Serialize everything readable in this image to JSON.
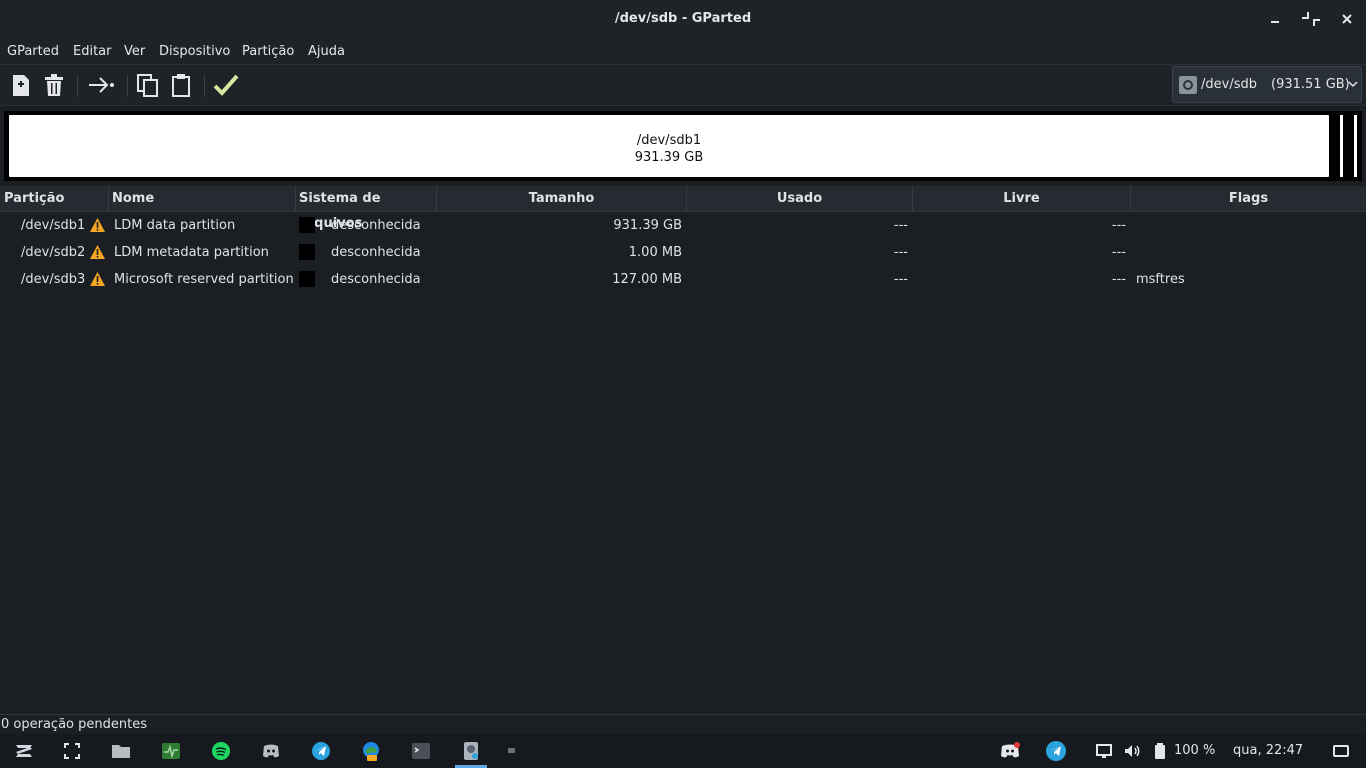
{
  "window": {
    "title": "/dev/sdb - GParted"
  },
  "menu": [
    "GParted",
    "Editar",
    "Ver",
    "Dispositivo",
    "Partição",
    "Ajuda"
  ],
  "toolbar": {
    "icons": [
      "new-partition-icon",
      "delete-icon",
      "resize-move-icon",
      "copy-icon",
      "paste-icon",
      "apply-icon"
    ]
  },
  "device_selector": {
    "device": "/dev/sdb",
    "size": "(931.51 GB)"
  },
  "disk_map": {
    "main_partition": {
      "name": "/dev/sdb1",
      "size": "931.39 GB"
    }
  },
  "table": {
    "headers": [
      "Partição",
      "Nome",
      "Sistema de arquivos",
      "Tamanho",
      "Usado",
      "Livre",
      "Flags"
    ],
    "rows": [
      {
        "partition": "/dev/sdb1",
        "name": "LDM data partition",
        "fs": "desconhecida",
        "size": "931.39 GB",
        "used": "---",
        "free": "---",
        "flags": ""
      },
      {
        "partition": "/dev/sdb2",
        "name": "LDM metadata partition",
        "fs": "desconhecida",
        "size": "1.00 MB",
        "used": "---",
        "free": "---",
        "flags": ""
      },
      {
        "partition": "/dev/sdb3",
        "name": "Microsoft reserved partition",
        "fs": "desconhecida",
        "size": "127.00 MB",
        "used": "---",
        "free": "---",
        "flags": "msftres"
      }
    ]
  },
  "status": {
    "pending": "0 operação pendentes"
  },
  "taskbar": {
    "battery": "100 %",
    "clock": "qua, 22:47"
  },
  "colors": {
    "background": "#1b1f24",
    "warning": "#f5a623",
    "apply_check": "#d7e6a0"
  }
}
